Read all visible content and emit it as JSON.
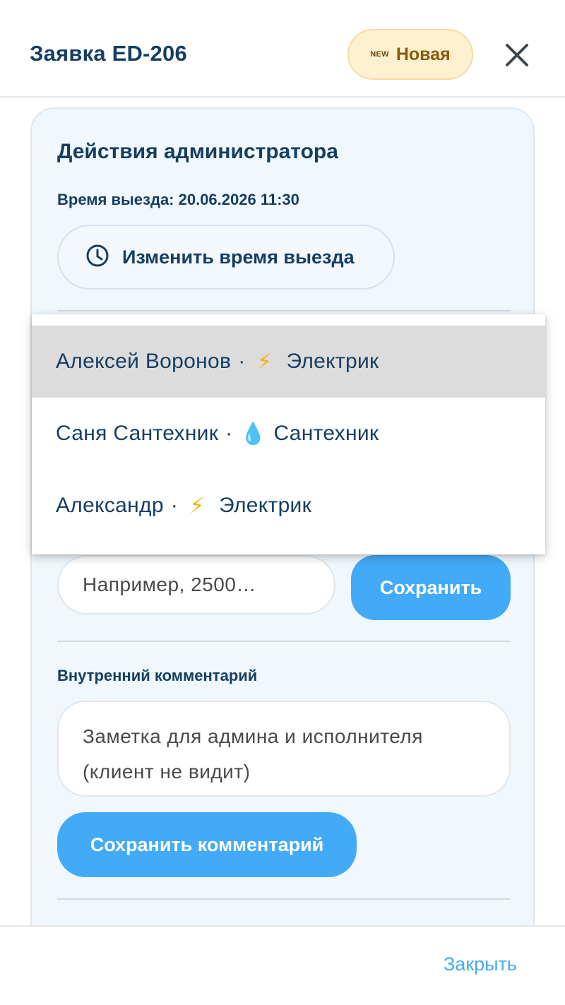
{
  "header": {
    "title": "Заявка ED-206",
    "status_mark": "NEW",
    "status_label": "Новая",
    "close_icon": "close-icon"
  },
  "admin_panel": {
    "title": "Действия администратора",
    "departure_time": "Время выезда: 20.06.2026 11:30",
    "change_time_label": "Изменить время выезда",
    "change_time_icon": "clock-icon",
    "amount_placeholder": "Например, 2500…",
    "save_label": "Сохранить",
    "comment_label": "Внутренний комментарий",
    "comment_placeholder": "Заметка для админа и исполнителя (клиент не видит)",
    "save_comment_label": "Сохранить комментарий"
  },
  "executor_dropdown": {
    "items": [
      {
        "name": "Алексей Воронов",
        "icon": "lightning-icon",
        "glyph": "⚡",
        "role": "Электрик",
        "highlighted": true
      },
      {
        "name": "Саня Сантехник",
        "icon": "water-drop-icon",
        "glyph": "💧",
        "role": "Сантехник",
        "highlighted": false
      },
      {
        "name": "Александр",
        "icon": "lightning-icon",
        "glyph": "⚡",
        "role": "Электрик",
        "highlighted": false
      }
    ]
  },
  "footer": {
    "close_label": "Закрыть"
  },
  "colors": {
    "accent": "#43aaf7",
    "title": "#163e63",
    "badge_bg": "#fff1cf",
    "badge_text": "#8a5a0c",
    "card_bg": "#f1f8fd",
    "lightning": "#f5b300",
    "drop": "#3a9be8"
  }
}
